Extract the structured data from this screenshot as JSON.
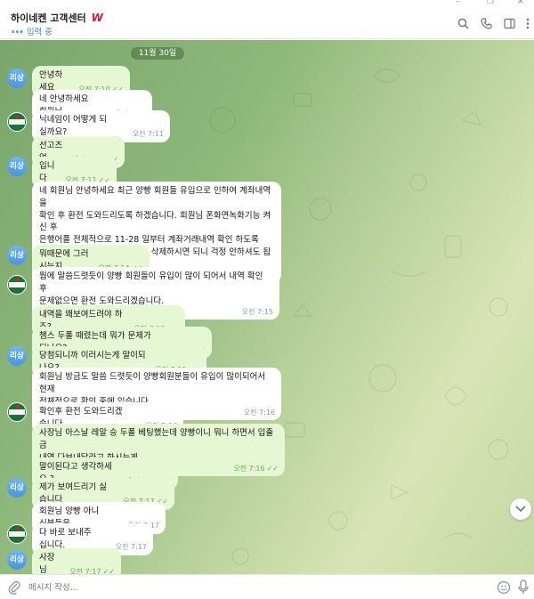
{
  "window": {
    "minimize_glyph": "–",
    "restore_glyph": "❐",
    "close_glyph": "✕"
  },
  "header": {
    "title": "하이네켄 고객센터",
    "logo_letter": "W",
    "status": "입력 중",
    "icons": [
      "search-icon",
      "phone-icon",
      "sidebar-icon",
      "more-icon"
    ]
  },
  "chat": {
    "date": "11월 30일",
    "messages": [
      {
        "sender": "blue",
        "avatar": "리상",
        "text": "안녕하세요",
        "time": "오전 7:10",
        "read": true
      },
      {
        "sender": "hk",
        "text": "네 안녕하세요 회원님",
        "time": "오전 7:11",
        "read": false
      },
      {
        "sender": "hk",
        "text": "닉네임이 어떻게 되실까요?",
        "time": "오전 7:11",
        "read": false
      },
      {
        "sender": "blue",
        "text": "선고즈업",
        "time": "오전 7:11",
        "read": true
      },
      {
        "sender": "blue",
        "text": "입니다",
        "time": "오전 7:11",
        "read": true
      },
      {
        "sender": "hk",
        "text": "네 회원님 안녕하세요 최근 양빵 회원들 유입으로 인하여 계좌내역을\n확인 후 환전 도와드리도록 하겠습니다. 회원님 폰화면녹화기능 켜신 후\n은행어플 전체적으로 11-28 일부터 계좌거래내역 확인 하도록\n하겠습니다 개인정보는 확인 후 삭제하시면 되니 걱정 안하셔도 됩니다.",
        "time": "오전 7:11",
        "read": false
      },
      {
        "sender": "blue",
        "text": "뭐때문에 그러시는지",
        "time": "오전 7:14",
        "read": true
      },
      {
        "sender": "hk",
        "text": "웜에 말씀드렷듯이 양빵 회원들이 유입이 많이 되어서 내역 확인 후\n문제없으면 환전 도와드리겠습니다.",
        "time": "오전 7:15",
        "read": false
      },
      {
        "sender": "blue",
        "text": "내역을 왜보여드려야 하죠?",
        "time": "오전 7:15",
        "read": true
      },
      {
        "sender": "blue",
        "text": "챔스 두폴 때렸는데 뭐가 문제가 되나요?",
        "time": "오전 7:15",
        "read": true
      },
      {
        "sender": "blue",
        "text": "당첨되니까 이러시는게 말이되나요?",
        "time": "오전 7:15",
        "read": true
      },
      {
        "sender": "hk",
        "text": "회원님 방금도 말씀 드렷듯이 양빵회원분들이 유입이 많이되어서 현재\n전체적으로 확인 중에 있습니다.",
        "time": "오전 7:16",
        "read": false
      },
      {
        "sender": "hk",
        "text": "확인후 환전 도와드리겠습니다.",
        "time": "오전 7:16",
        "read": false
      },
      {
        "sender": "blue",
        "text": "사장님 아스날 레알 승 두폴 베팅했는데 양빵이니 뭐니 하면서 입출금\n내역 다보내달라고 하시는게",
        "time": "오전 7:16",
        "read": true
      },
      {
        "sender": "blue",
        "text": "말이된다고 생각하세요 ?",
        "time": "오전 7:16",
        "read": true
      },
      {
        "sender": "blue",
        "text": "제가 보여드리기 싫습니다",
        "time": "오전 7:17",
        "read": true
      },
      {
        "sender": "hk",
        "text": "회원님 양빵 아니신분들은",
        "time": "오전 7:17",
        "read": false
      },
      {
        "sender": "hk",
        "text": "다 바로 보내주십니다.",
        "time": "오전 7:17",
        "read": false
      },
      {
        "sender": "blue",
        "text": "사장님",
        "time": "오전 7:17",
        "read": true
      }
    ]
  },
  "composer": {
    "placeholder": "메시지 작성..."
  }
}
